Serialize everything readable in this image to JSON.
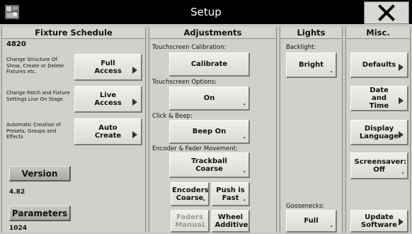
{
  "window": {
    "title": "Setup",
    "app_icon": "app-icon",
    "close_icon": "close-icon"
  },
  "fixture_schedule": {
    "header": "Fixture Schedule",
    "count": "4820",
    "rows": [
      {
        "description": "Change Structure Of Show, Create or Delete Fixtures etc.",
        "button": "Full Access"
      },
      {
        "description": "Change Patch and Fixture Settings Live On Stage",
        "button": "Live Access"
      },
      {
        "description": "Automatic Creation of Presets, Groups and Effects",
        "button": "Auto Create"
      }
    ],
    "version_label": "Version",
    "version_value": "4.82",
    "parameters_label": "Parameters",
    "parameters_value": "1024"
  },
  "adjustments": {
    "header": "Adjustments",
    "touch_calibration_label": "Touchscreen Calibration:",
    "calibrate_button": "Calibrate",
    "touch_options_label": "Touchscreen Options:",
    "touch_options_value": "On",
    "click_beep_label": "Click & Beep:",
    "click_beep_value": "Beep On",
    "encoder_label": "Encoder & Fader Movement:",
    "trackball_value": "Trackball Coarse",
    "encoders_value": "Encoders Coarse",
    "push_value": "Push is Fast",
    "faders_value": "Faders Manual",
    "wheel_value": "Wheel Additive"
  },
  "lights": {
    "header": "Lights",
    "backlight_label": "Backlight:",
    "backlight_value": "Bright",
    "goosenecks_label": "Goosenecks:",
    "goosenecks_value": "Full"
  },
  "misc": {
    "header": "Misc.",
    "defaults_button": "Defaults",
    "date_time_button": "Date and Time",
    "display_language_button": "Display Language",
    "screensaver_button": "Screensaver: Off",
    "update_software_button": "Update Software"
  }
}
